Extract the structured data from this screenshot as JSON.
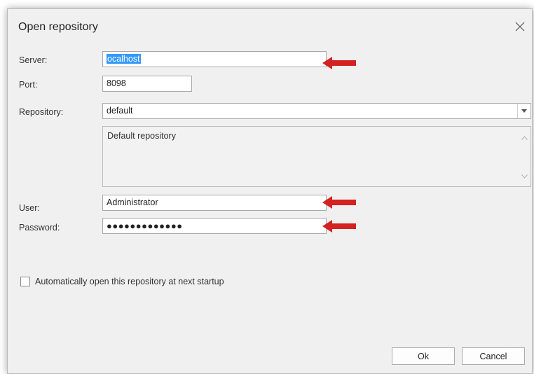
{
  "dialog": {
    "title": "Open repository",
    "close_icon": "close-icon"
  },
  "form": {
    "server": {
      "label": "Server:",
      "value": "ocalhost"
    },
    "port": {
      "label": "Port:",
      "value": "8098"
    },
    "repository": {
      "label": "Repository:",
      "value": "default",
      "description": "Default repository"
    },
    "user": {
      "label": "User:",
      "value": "Administrator"
    },
    "password": {
      "label": "Password:",
      "value": "●●●●●●●●●●●●●"
    },
    "auto_open": {
      "label": "Automatically open this repository at next startup",
      "checked": false
    }
  },
  "buttons": {
    "ok": "Ok",
    "cancel": "Cancel"
  },
  "annotations": {
    "arrow_color": "#d42121",
    "highlight_color": "#3399ff"
  }
}
